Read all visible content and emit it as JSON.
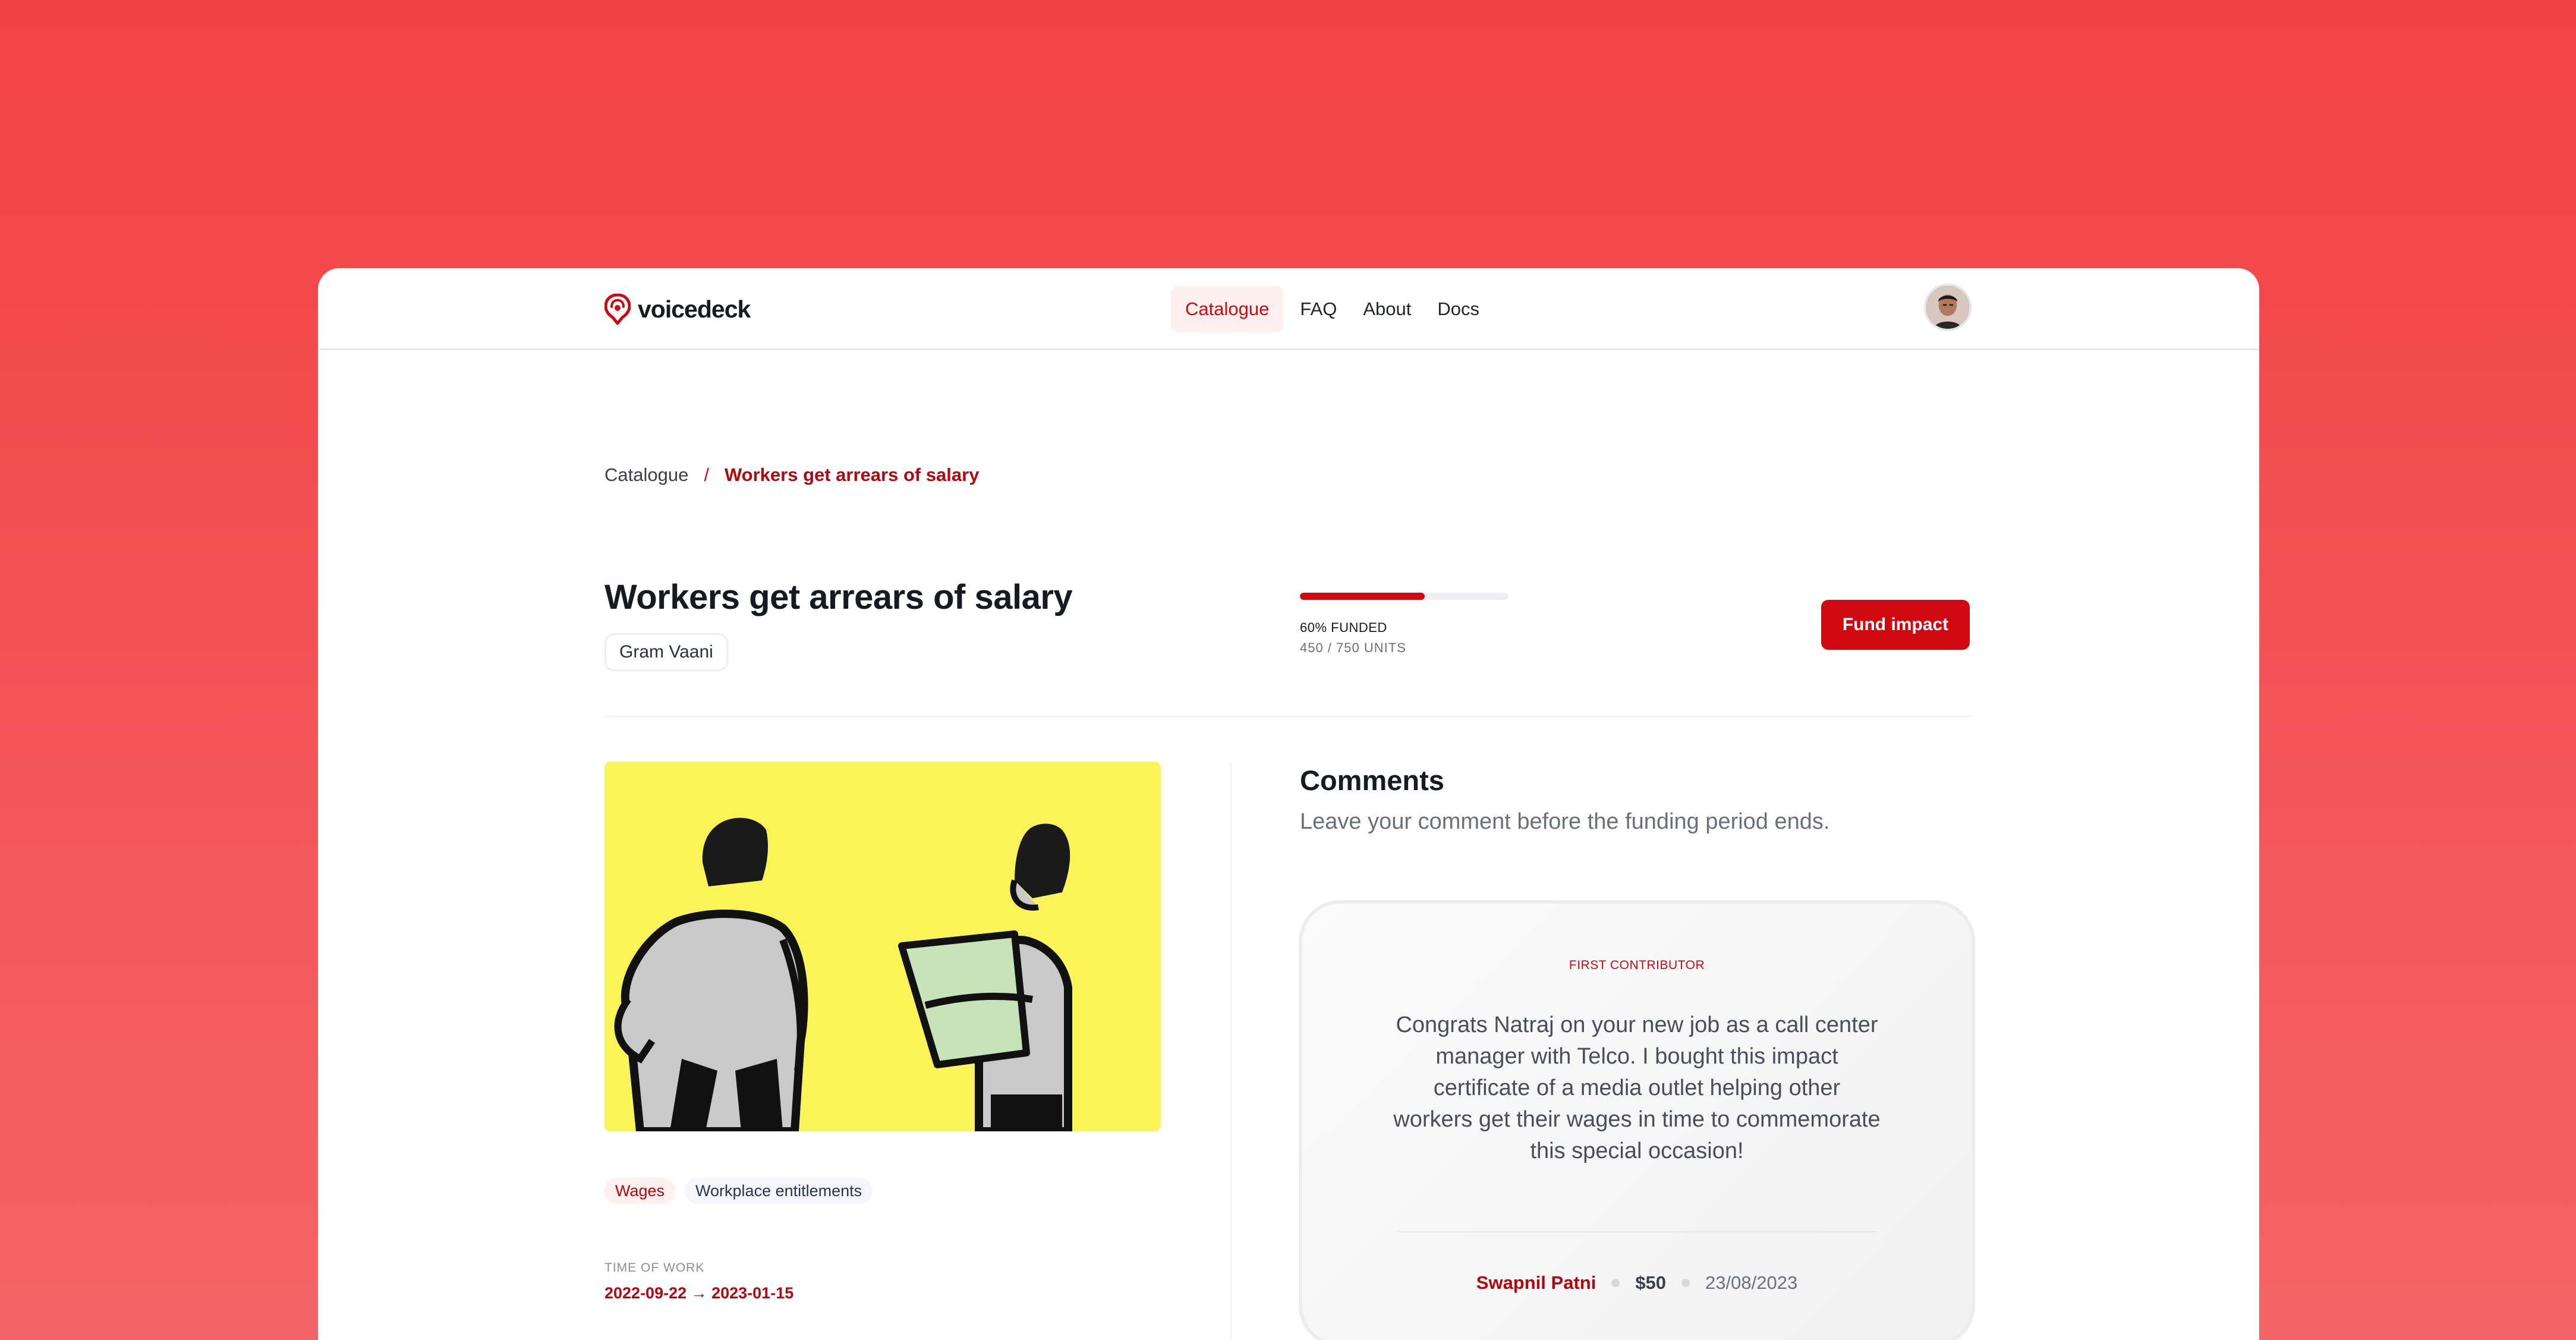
{
  "app": {
    "brand": "voicedeck",
    "brand_color": "#d0080f"
  },
  "nav": {
    "items": [
      {
        "label": "Catalogue",
        "active": true
      },
      {
        "label": "FAQ",
        "active": false
      },
      {
        "label": "About",
        "active": false
      },
      {
        "label": "Docs",
        "active": false
      }
    ]
  },
  "breadcrumb": {
    "parent": "Catalogue",
    "separator": "/",
    "current": "Workers get arrears of salary"
  },
  "project": {
    "title": "Workers get arrears of salary",
    "organization": "Gram Vaani",
    "funded_label": "60% FUNDED",
    "funded_fraction": 0.6,
    "units_label": "450 / 750 UNITS",
    "fund_button": "Fund impact",
    "tags": [
      {
        "label": "Wages",
        "style": "red"
      },
      {
        "label": "Workplace entitlements",
        "style": "gray"
      }
    ],
    "time_of_work_label": "TIME OF WORK",
    "time_of_work_value": "2022-09-22 → 2023-01-15"
  },
  "comments": {
    "title": "Comments",
    "subtitle": "Leave your comment before the funding period ends.",
    "card": {
      "label": "FIRST CONTRIBUTOR",
      "quote": "Congrats Natraj on your new job as a call center manager with Telco. I bought this impact certificate of a media outlet helping other workers get their wages in time to commemorate this special occasion!",
      "author": "Swapnil Patni",
      "amount": "$50",
      "date": "23/08/2023"
    }
  },
  "icons": {
    "logo": "voicedeck-logo-icon",
    "avatar": "user-avatar"
  }
}
